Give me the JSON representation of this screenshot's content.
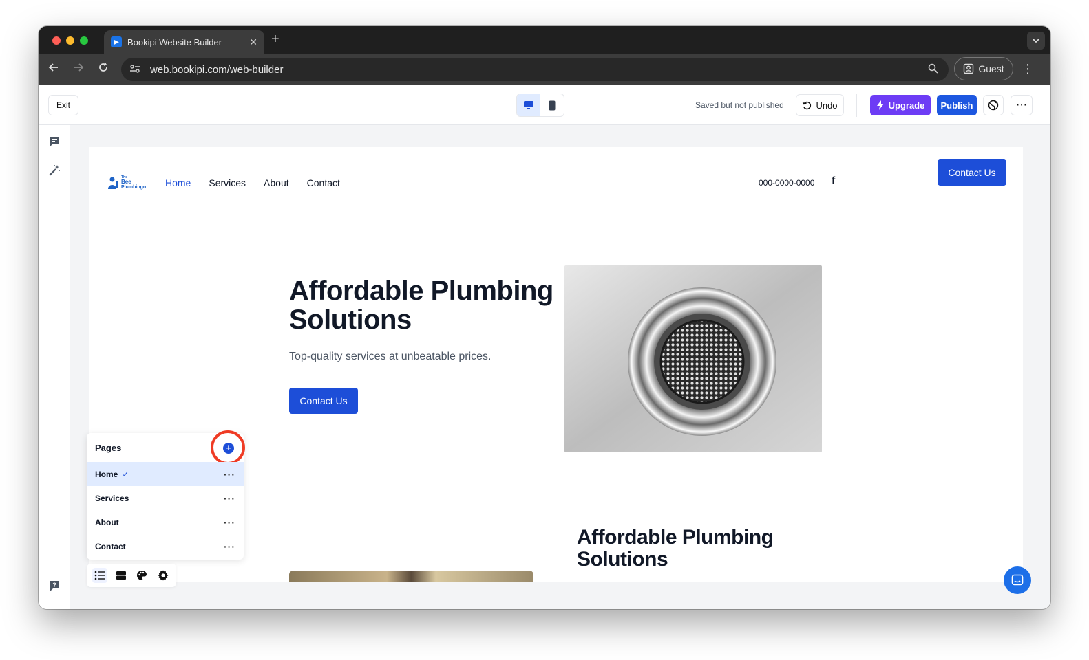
{
  "browser": {
    "tab_title": "Bookipi Website Builder",
    "tab_close": "✕",
    "new_tab": "+",
    "url": "web.bookipi.com/web-builder",
    "profile_label": "Guest"
  },
  "toolbar": {
    "exit_label": "Exit",
    "status_text": "Saved but not published",
    "undo_label": "Undo",
    "upgrade_label": "Upgrade",
    "publish_label": "Publish",
    "more_label": "···"
  },
  "site": {
    "logo_text_1": "The",
    "logo_text_2": "Bee",
    "logo_text_3": "Plumbingo",
    "nav": [
      "Home",
      "Services",
      "About",
      "Contact"
    ],
    "active_nav": "Home",
    "phone": "000-0000-0000",
    "facebook_glyph": "f",
    "header_cta": "Contact Us",
    "hero_title": "Affordable Plumbing Solutions",
    "hero_subtitle": "Top-quality services at unbeatable prices.",
    "hero_cta": "Contact Us",
    "section2_title": "Affordable Plumbing Solutions"
  },
  "pages_panel": {
    "title": "Pages",
    "add_symbol": "+",
    "pages": [
      {
        "label": "Home",
        "active": true,
        "check": "✓",
        "more": "···"
      },
      {
        "label": "Services",
        "active": false,
        "more": "···"
      },
      {
        "label": "About",
        "active": false,
        "more": "···"
      },
      {
        "label": "Contact",
        "active": false,
        "more": "···"
      }
    ]
  },
  "colors": {
    "brand_blue": "#1d4ed8",
    "upgrade_purple": "#6d3cf5",
    "highlight_ring": "#ef3b24"
  },
  "icons": [
    "search-icon",
    "reload-icon",
    "back-icon",
    "forward-icon",
    "desktop-icon",
    "mobile-icon",
    "undo-icon",
    "bolt-icon",
    "globe-icon",
    "comment-icon",
    "magic-wand-icon",
    "help-icon",
    "list-icon",
    "sections-icon",
    "palette-icon",
    "gear-icon",
    "chat-icon",
    "facebook-icon"
  ]
}
